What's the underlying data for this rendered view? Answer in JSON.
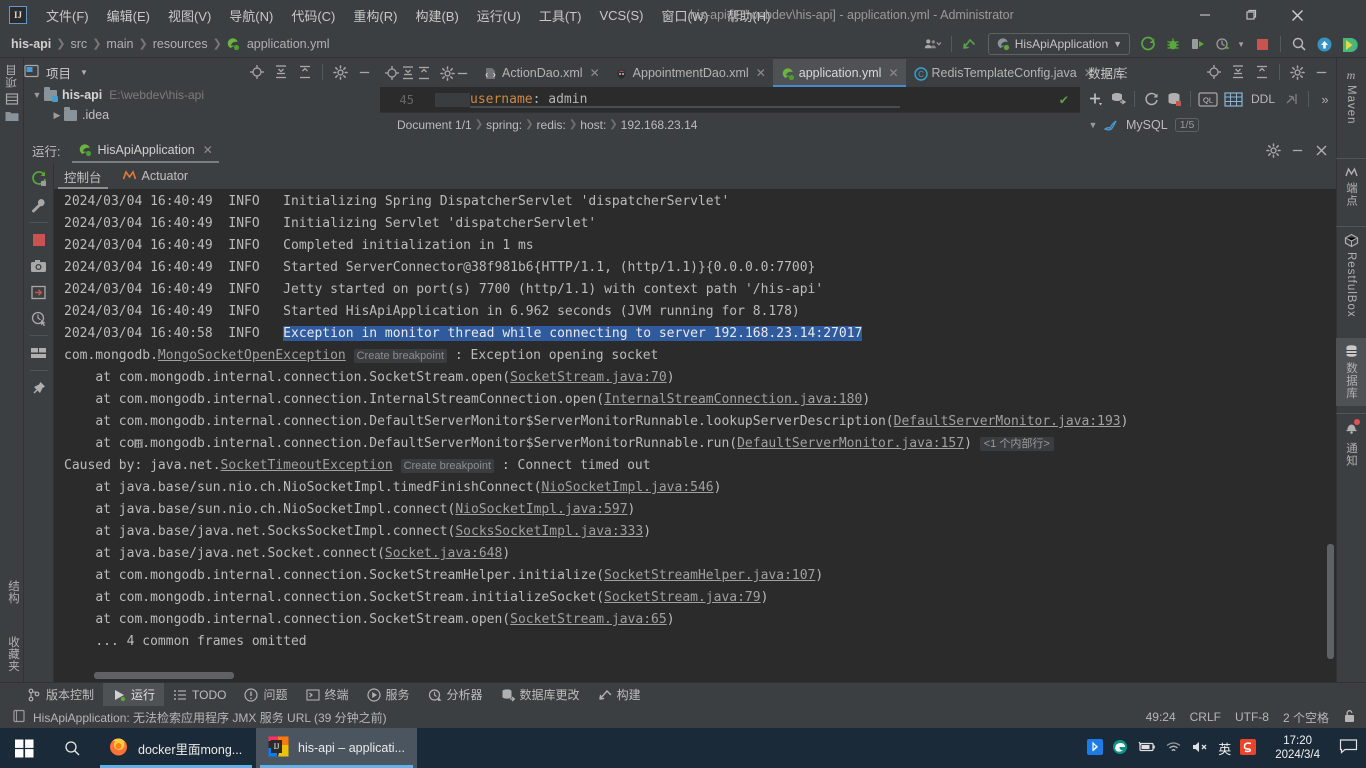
{
  "window": {
    "title": "his-api [E:\\webdev\\his-api] - application.yml - Administrator",
    "minimize": "–",
    "maximize": "❐",
    "close": "✕"
  },
  "menubar": {
    "items": [
      {
        "label": "文件(F)"
      },
      {
        "label": "编辑(E)"
      },
      {
        "label": "视图(V)"
      },
      {
        "label": "导航(N)"
      },
      {
        "label": "代码(C)"
      },
      {
        "label": "重构(R)"
      },
      {
        "label": "构建(B)"
      },
      {
        "label": "运行(U)"
      },
      {
        "label": "工具(T)"
      },
      {
        "label": "VCS(S)"
      },
      {
        "label": "窗口(W)"
      },
      {
        "label": "帮助(H)"
      }
    ]
  },
  "navbar": {
    "breadcrumbs": [
      "his-api",
      "src",
      "main",
      "resources",
      "application.yml"
    ],
    "run_config": "HisApiApplication",
    "icons": [
      "user-dropdown-icon",
      "vcs-update-icon",
      "run-icon",
      "debug-icon",
      "run-coverage-icon",
      "profiler-icon",
      "stop-icon",
      "search-icon",
      "update-icon",
      "ide-feature-icon"
    ]
  },
  "project_panel": {
    "title": "项目",
    "tree": [
      {
        "label": "his-api",
        "path": "E:\\webdev\\his-api",
        "expanded": true,
        "bold": true
      },
      {
        "label": ".idea",
        "path": "",
        "expanded": false,
        "bold": false
      }
    ]
  },
  "editor_tabs": [
    {
      "label": "ActionDao.xml",
      "icon": "xml-file-icon",
      "active": false
    },
    {
      "label": "AppointmentDao.xml",
      "icon": "mybatis-file-icon",
      "active": false
    },
    {
      "label": "application.yml",
      "icon": "spring-yml-icon",
      "active": true
    },
    {
      "label": "RedisTemplateConfig.java",
      "icon": "java-class-icon",
      "active": false
    }
  ],
  "editor": {
    "line_number": "45",
    "code_key": "username",
    "code_colon": ":",
    "code_value": " admin",
    "inspection_status": "✔"
  },
  "breadcrumb_bar": {
    "items": [
      "Document 1/1",
      "spring:",
      "redis:",
      "host:",
      "192.168.23.14"
    ]
  },
  "database_panel": {
    "title": "数据库",
    "toolbar": [
      "add-icon",
      "query-console-icon",
      "refresh-icon",
      "db-drop-icon",
      "ql-icon",
      "table-icon",
      "DDL",
      "jump-icon",
      "more-icon"
    ],
    "ddl_label": "DDL",
    "ql_label": "QL",
    "more_label": "»",
    "connection": {
      "name": "MySQL",
      "badge": "1/5"
    }
  },
  "run_panel": {
    "run_label": "运行:",
    "run_tab": "HisApiApplication",
    "tabs": [
      {
        "label": "控制台",
        "icon": "console-icon",
        "active": true
      },
      {
        "label": "Actuator",
        "icon": "actuator-icon",
        "active": false
      }
    ],
    "side_icons": [
      "rerun-icon",
      "wrench-icon",
      "stop-icon",
      "camera-icon",
      "export-icon",
      "history-icon",
      "layout-icon",
      "pin-icon"
    ]
  },
  "console": {
    "lines": [
      {
        "type": "log",
        "ts": "2024/03/04 16:40:49",
        "level": "INFO",
        "msg": "Initializing Spring DispatcherServlet 'dispatcherServlet'"
      },
      {
        "type": "log",
        "ts": "2024/03/04 16:40:49",
        "level": "INFO",
        "msg": "Initializing Servlet 'dispatcherServlet'"
      },
      {
        "type": "log",
        "ts": "2024/03/04 16:40:49",
        "level": "INFO",
        "msg": "Completed initialization in 1 ms"
      },
      {
        "type": "log",
        "ts": "2024/03/04 16:40:49",
        "level": "INFO",
        "msg": "Started ServerConnector@38f981b6{HTTP/1.1, (http/1.1)}{0.0.0.0:7700}"
      },
      {
        "type": "log",
        "ts": "2024/03/04 16:40:49",
        "level": "INFO",
        "msg": "Jetty started on port(s) 7700 (http/1.1) with context path '/his-api'"
      },
      {
        "type": "log",
        "ts": "2024/03/04 16:40:49",
        "level": "INFO",
        "msg": "Started HisApiApplication in 6.962 seconds (JVM running for 8.178)"
      },
      {
        "type": "log-selected",
        "ts": "2024/03/04 16:40:58",
        "level": "INFO",
        "msg": "Exception in monitor thread while connecting to server 192.168.23.14:27017"
      }
    ],
    "exception_header": {
      "prefix": "com.mongodb.",
      "link": "MongoSocketOpenException",
      "breakpoint": "Create breakpoint",
      "suffix": " : Exception opening socket"
    },
    "stack": [
      {
        "indent": 1,
        "prefix": "at com.mongodb.internal.connection.SocketStream.open(",
        "link": "SocketStream.java:70",
        "suffix": ")"
      },
      {
        "indent": 1,
        "prefix": "at com.mongodb.internal.connection.InternalStreamConnection.open(",
        "link": "InternalStreamConnection.java:180",
        "suffix": ")"
      },
      {
        "indent": 1,
        "prefix": "at com.mongodb.internal.connection.DefaultServerMonitor$ServerMonitorRunnable.lookupServerDescription(",
        "link": "DefaultServerMonitor.java:193",
        "suffix": ")"
      },
      {
        "indent": 1,
        "prefix": "at com.mongodb.internal.connection.DefaultServerMonitor$ServerMonitorRunnable.run(",
        "link": "DefaultServerMonitor.java:157",
        "suffix": ")",
        "note": "<1 个内部行>",
        "fold": true
      }
    ],
    "caused_by": {
      "prefix": "Caused by: java.net.",
      "link": "SocketTimeoutException",
      "breakpoint": "Create breakpoint",
      "suffix": " : Connect timed out"
    },
    "stack2": [
      {
        "prefix": "at java.base/sun.nio.ch.NioSocketImpl.timedFinishConnect(",
        "link": "NioSocketImpl.java:546",
        "suffix": ")"
      },
      {
        "prefix": "at java.base/sun.nio.ch.NioSocketImpl.connect(",
        "link": "NioSocketImpl.java:597",
        "suffix": ")"
      },
      {
        "prefix": "at java.base/java.net.SocksSocketImpl.connect(",
        "link": "SocksSocketImpl.java:333",
        "suffix": ")"
      },
      {
        "prefix": "at java.base/java.net.Socket.connect(",
        "link": "Socket.java:648",
        "suffix": ")"
      },
      {
        "prefix": "at com.mongodb.internal.connection.SocketStreamHelper.initialize(",
        "link": "SocketStreamHelper.java:107",
        "suffix": ")"
      },
      {
        "prefix": "at com.mongodb.internal.connection.SocketStream.initializeSocket(",
        "link": "SocketStream.java:79",
        "suffix": ")"
      },
      {
        "prefix": "at com.mongodb.internal.connection.SocketStream.open(",
        "link": "SocketStream.java:65",
        "suffix": ")"
      }
    ],
    "omitted": "... 4 common frames omitted"
  },
  "left_edge": {
    "tabs": [
      {
        "label": "项目",
        "icon": "project-icon"
      }
    ],
    "bottom_tabs": [
      {
        "label": "收藏夹",
        "icon": "favorites-icon"
      },
      {
        "label": "结构",
        "icon": "structure-icon"
      }
    ]
  },
  "right_edge": {
    "items": [
      {
        "label": "Maven",
        "icon": "maven-icon",
        "active": false
      },
      {
        "label": "端点",
        "icon": "endpoints-icon",
        "active": false
      },
      {
        "label": "RestfulBox",
        "icon": "restfulbox-icon",
        "active": false
      },
      {
        "label": "数据库",
        "icon": "database-icon",
        "active": true
      },
      {
        "label": "通知",
        "icon": "notifications-icon",
        "active": false
      }
    ]
  },
  "bottom_strip": {
    "tabs": [
      {
        "label": "版本控制",
        "icon": "vcs-icon",
        "active": false
      },
      {
        "label": "运行",
        "icon": "run-icon",
        "active": true
      },
      {
        "label": "TODO",
        "icon": "todo-icon",
        "active": false
      },
      {
        "label": "问题",
        "icon": "problems-icon",
        "active": false
      },
      {
        "label": "终端",
        "icon": "terminal-icon",
        "active": false
      },
      {
        "label": "服务",
        "icon": "services-icon",
        "active": false
      },
      {
        "label": "分析器",
        "icon": "profiler-icon",
        "active": false
      },
      {
        "label": "数据库更改",
        "icon": "db-changes-icon",
        "active": false
      },
      {
        "label": "构建",
        "icon": "build-icon",
        "active": false
      }
    ]
  },
  "statusbar": {
    "message": "HisApiApplication: 无法检索应用程序 JMX 服务 URL (39 分钟之前)",
    "caret": "49:24",
    "line_sep": "CRLF",
    "encoding": "UTF-8",
    "indent": "2 个空格",
    "lock": "lock-icon"
  },
  "taskbar": {
    "start": "windows-start-icon",
    "search": "search-icon",
    "apps": [
      {
        "label": "docker里面mong...",
        "icon": "firefox-icon",
        "active": false
      },
      {
        "label": "his-api – applicati...",
        "icon": "intellij-icon",
        "active": true
      }
    ],
    "tray_icons": [
      "bluetooth-icon",
      "edge-icon",
      "battery-icon",
      "wifi-icon",
      "volume-muted-icon",
      "ime-chinese-icon",
      "sogou-icon"
    ],
    "clock_time": "17:20",
    "clock_date": "2024/3/4",
    "notifications": "notification-icon"
  },
  "colors": {
    "bg_panel": "#3c3f41",
    "bg_editor": "#2b2b2b",
    "accent_blue": "#4a88c7",
    "selection": "#2f5b9e",
    "taskbar": "#1b2a38"
  }
}
